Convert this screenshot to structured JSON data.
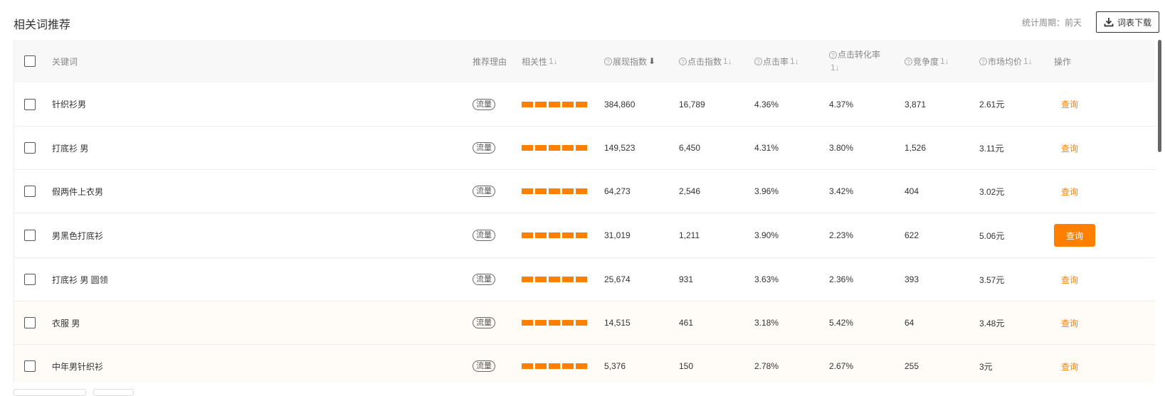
{
  "page": {
    "title": "相关词推荐",
    "period": "统计周期：前天",
    "download_label": "词表下载"
  },
  "table": {
    "headers": {
      "keyword": "关键词",
      "reason": "推荐理由",
      "relevance": "相关性",
      "impressions": "展现指数",
      "clicks": "点击指数",
      "ctr": "点击率",
      "cvr_line1": "点击转化率",
      "competition": "竞争度",
      "price": "市场均价",
      "action": "操作"
    },
    "help_icon": "question-circle-icon",
    "sort_icon": "↑↓",
    "sort_active_icon": "⬇",
    "rows": [
      {
        "keyword": "针织衫男",
        "reason": "流量",
        "relevance": 5,
        "impressions": "384,860",
        "clicks": "16,789",
        "ctr": "4.36%",
        "cvr": "4.37%",
        "competition": "3,871",
        "price": "2.61元",
        "action": "查询"
      },
      {
        "keyword": "打底衫 男",
        "reason": "流量",
        "relevance": 5,
        "impressions": "149,523",
        "clicks": "6,450",
        "ctr": "4.31%",
        "cvr": "3.80%",
        "competition": "1,526",
        "price": "3.11元",
        "action": "查询"
      },
      {
        "keyword": "假两件上衣男",
        "reason": "流量",
        "relevance": 5,
        "impressions": "64,273",
        "clicks": "2,546",
        "ctr": "3.96%",
        "cvr": "3.42%",
        "competition": "404",
        "price": "3.02元",
        "action": "查询"
      },
      {
        "keyword": "男黑色打底衫",
        "reason": "流量",
        "relevance": 5,
        "impressions": "31,019",
        "clicks": "1,211",
        "ctr": "3.90%",
        "cvr": "2.23%",
        "competition": "622",
        "price": "5.06元",
        "action": "查询"
      },
      {
        "keyword": "打底衫 男 圆领",
        "reason": "流量",
        "relevance": 5,
        "impressions": "25,674",
        "clicks": "931",
        "ctr": "3.63%",
        "cvr": "2.36%",
        "competition": "393",
        "price": "3.57元",
        "action": "查询"
      },
      {
        "keyword": "衣服 男",
        "reason": "流量",
        "relevance": 5,
        "impressions": "14,515",
        "clicks": "461",
        "ctr": "3.18%",
        "cvr": "5.42%",
        "competition": "64",
        "price": "3.48元",
        "action": "查询"
      },
      {
        "keyword": "中年男针织衫",
        "reason": "流量",
        "relevance": 5,
        "impressions": "5,376",
        "clicks": "150",
        "ctr": "2.78%",
        "cvr": "2.67%",
        "competition": "255",
        "price": "3元",
        "action": "查询"
      }
    ],
    "hovered_row": 3
  },
  "colors": {
    "accent": "#ff8000"
  }
}
